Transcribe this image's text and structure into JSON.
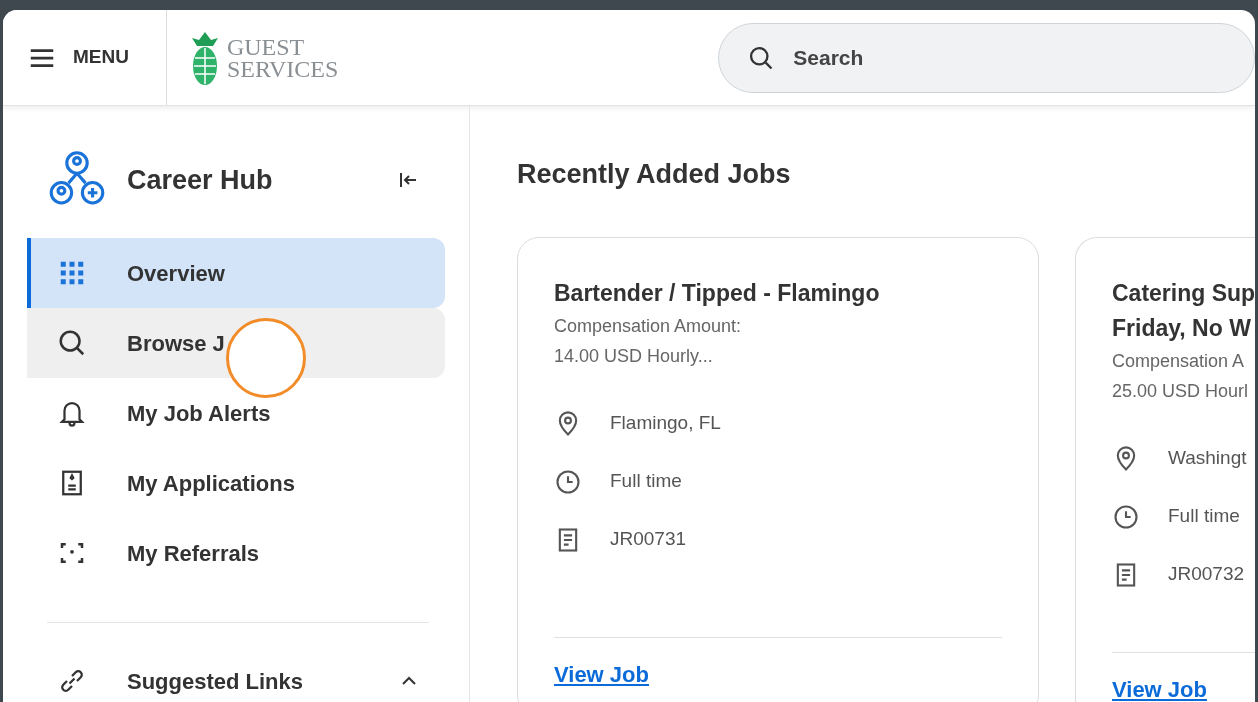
{
  "header": {
    "menu_label": "MENU",
    "logo_line_1": "GUEST",
    "logo_line_2": "SERVICES",
    "search": {
      "placeholder": "Search"
    }
  },
  "sidebar": {
    "title": "Career Hub",
    "items": [
      {
        "label": "Overview",
        "selected": true,
        "hovered": false
      },
      {
        "label": "Browse J",
        "selected": false,
        "hovered": true
      },
      {
        "label": "My Job Alerts",
        "selected": false,
        "hovered": false
      },
      {
        "label": "My Applications",
        "selected": false,
        "hovered": false
      },
      {
        "label": "My Referrals",
        "selected": false,
        "hovered": false
      }
    ],
    "section": {
      "label": "Suggested Links",
      "expanded": true
    }
  },
  "main": {
    "title": "Recently Added Jobs",
    "jobs": [
      {
        "title": "Bartender / Tipped - Flamingo",
        "compensation_label": "Compensation Amount:",
        "compensation": "14.00 USD Hourly...",
        "location": "Flamingo, FL",
        "schedule": "Full time",
        "requisition": "JR00731",
        "link": "View Job"
      },
      {
        "title": "Catering Sup\nFriday, No W",
        "compensation_label": "Compensation A",
        "compensation": "25.00 USD Hourl",
        "location": "Washingt",
        "schedule": "Full time",
        "requisition": "JR00732",
        "link": "View Job"
      }
    ]
  },
  "click_indicator": true
}
